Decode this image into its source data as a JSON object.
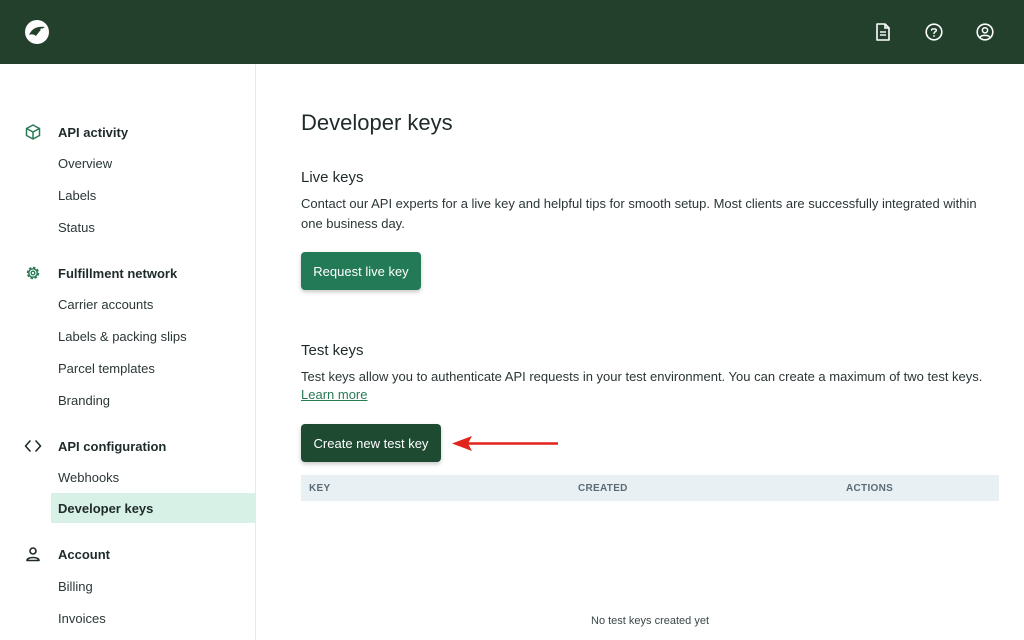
{
  "colors": {
    "topbar": "#23402d",
    "accent": "#237a57",
    "accent_dark": "#1e4a32",
    "active_nav_bg": "#d8f1e6",
    "table_head_bg": "#e9f0f3",
    "annotation_arrow": "#e3241b"
  },
  "topbar": {
    "logo_icon": "bird-logo-icon",
    "icons": [
      "document-icon",
      "help-circle-icon",
      "user-circle-icon"
    ]
  },
  "sidebar": {
    "sections": [
      {
        "title": "API activity",
        "icon": "box-icon",
        "items": [
          "Overview",
          "Labels",
          "Status"
        ]
      },
      {
        "title": "Fulfillment network",
        "icon": "gear-icon",
        "items": [
          "Carrier accounts",
          "Labels & packing slips",
          "Parcel templates",
          "Branding"
        ]
      },
      {
        "title": "API configuration",
        "icon": "code-icon",
        "items": [
          "Webhooks",
          "Developer keys"
        ]
      },
      {
        "title": "Account",
        "icon": "person-icon",
        "items": [
          "Billing",
          "Invoices"
        ]
      }
    ],
    "active_item": "Developer keys"
  },
  "main": {
    "title": "Developer keys",
    "live": {
      "heading": "Live keys",
      "description": "Contact our API experts for a live key and helpful tips for smooth setup. Most clients are successfully integrated within one business day.",
      "button_label": "Request live key"
    },
    "test": {
      "heading": "Test keys",
      "description": "Test keys allow you to authenticate API requests in your test environment. You can create a maximum of two test keys.",
      "learn_more": "Learn more",
      "button_label": "Create new test key"
    },
    "table": {
      "columns": [
        "KEY",
        "CREATED",
        "ACTIONS"
      ],
      "empty_text": "No test keys created yet"
    }
  }
}
